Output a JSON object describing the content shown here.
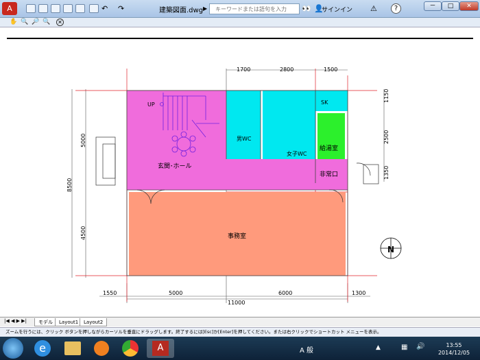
{
  "window": {
    "title": "建築図面.dwg",
    "search_placeholder": "キーワードまたは語句を入力",
    "signin": "サインイン",
    "btn_min": "－",
    "btn_max": "□",
    "btn_close": "✕"
  },
  "drawing": {
    "dims_top": [
      "1700",
      "2800",
      "1500"
    ],
    "dims_right": [
      "1150",
      "2500",
      "1350"
    ],
    "dims_left": [
      "5000",
      "8500",
      "4500"
    ],
    "dims_bottom": [
      "1550",
      "5000",
      "6000",
      "1300"
    ],
    "dim_total": "11000",
    "rooms": {
      "up": "UP",
      "hall": "玄関･ホール",
      "mens_wc": "男WC",
      "womens_wc": "女子WC",
      "sk": "SK",
      "kitchen": "給湯室",
      "exit": "非常口",
      "office": "事務室"
    },
    "compass": "N"
  },
  "tabs": [
    "モデル",
    "Layout1",
    "Layout2"
  ],
  "status": "ズームを行うには、クリック ボタンを押しながらカーソルを垂直にドラッグします。終了するには[Esc]か[Enter]を押してください。または右クリックでショートカット メニューを表示。",
  "taskbar": {
    "time": "13:55",
    "date": "2014/12/05",
    "ime": "A 般"
  },
  "colors": {
    "hall": "#f06cdc",
    "wc": "#00e8f0",
    "kitchen": "#2cf02c",
    "office": "#ff9a7c"
  }
}
